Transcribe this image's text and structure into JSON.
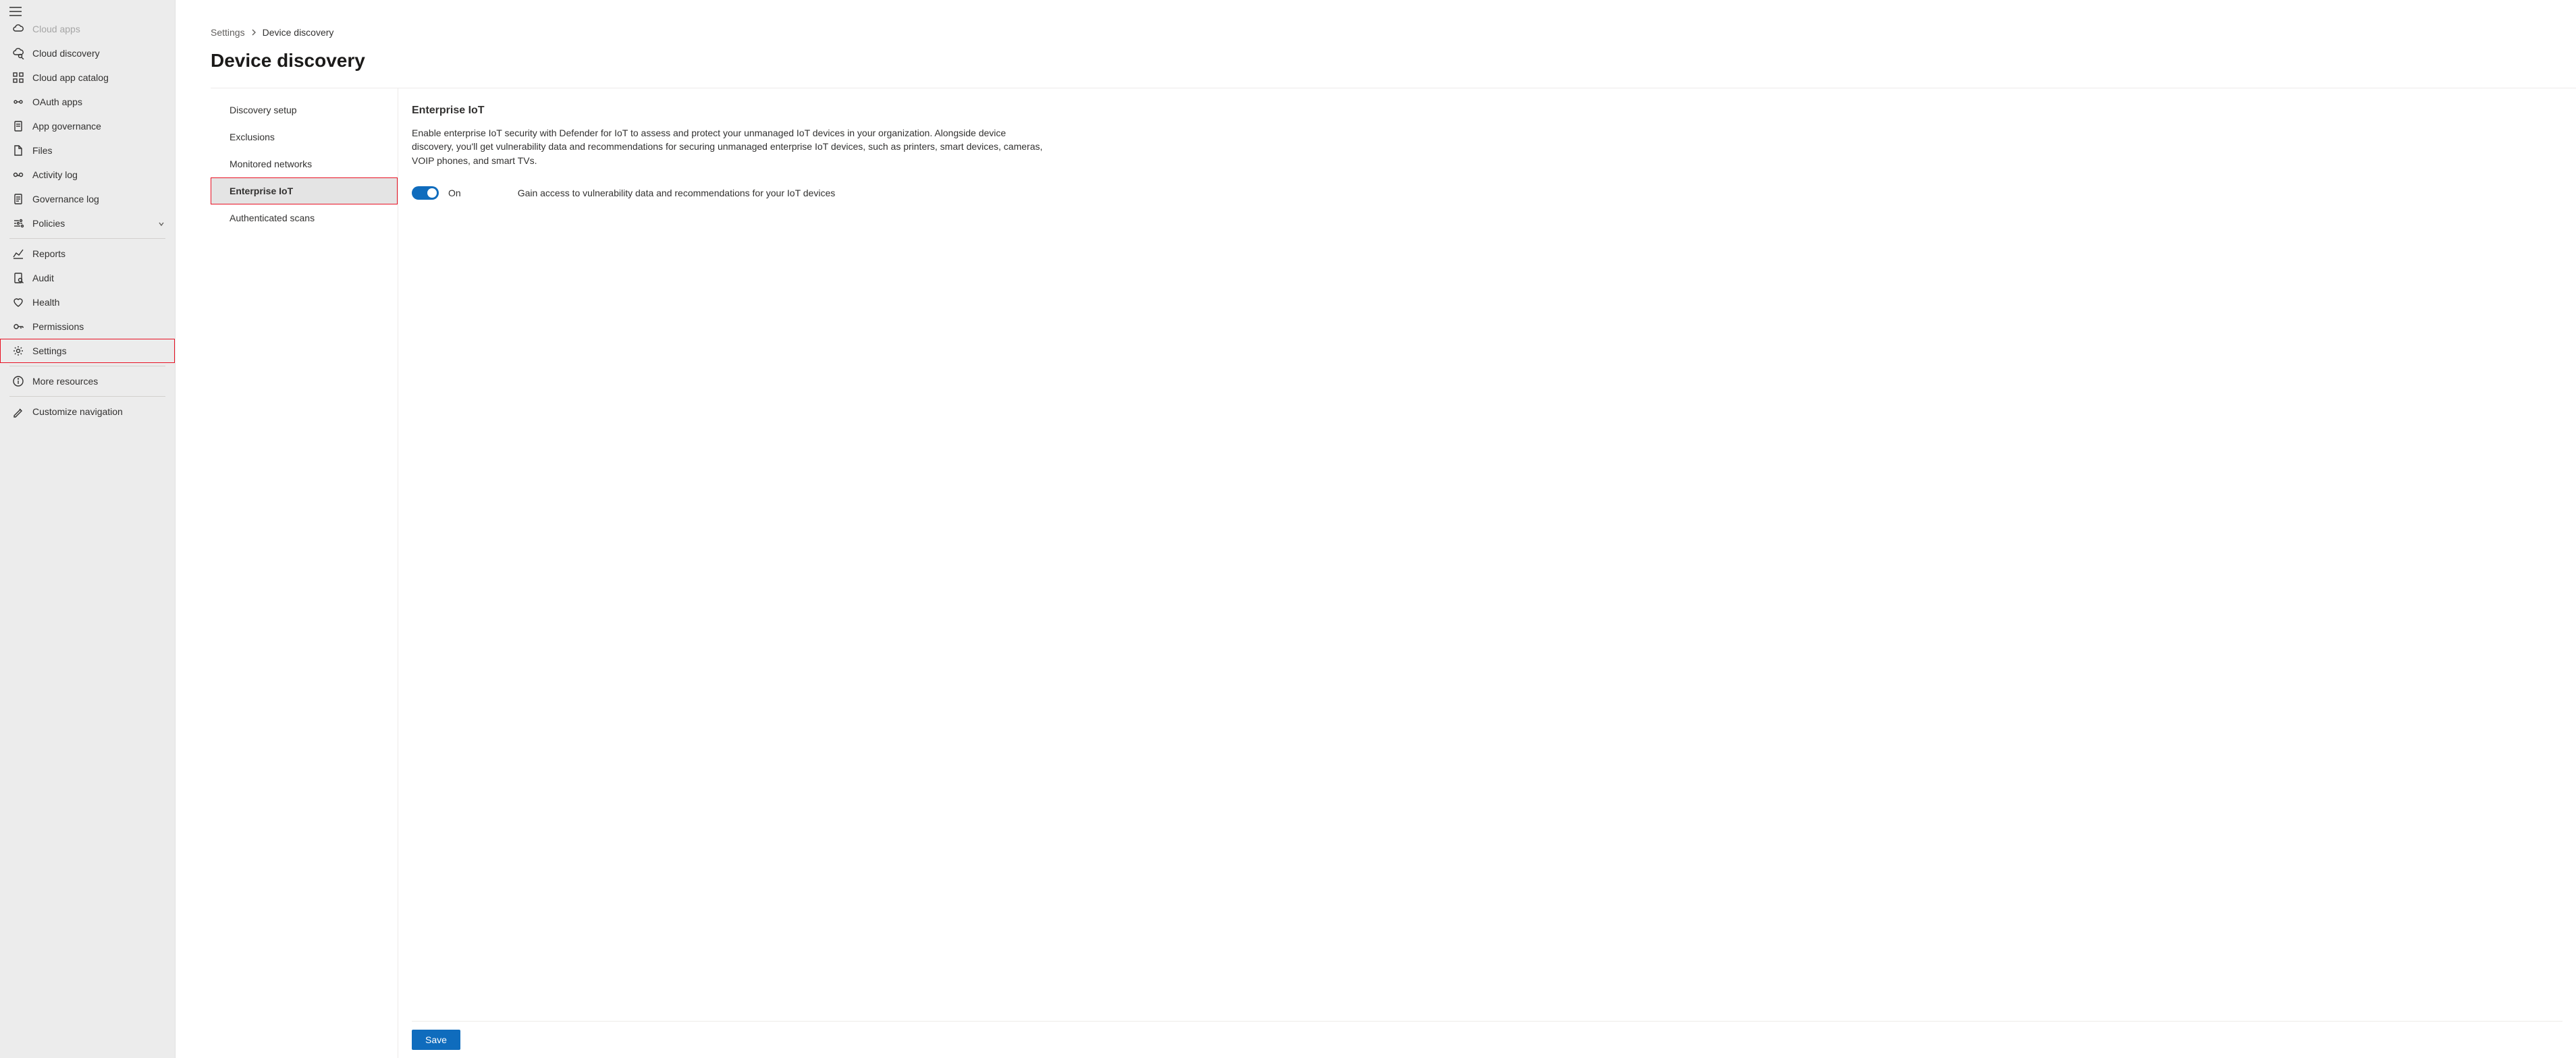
{
  "sidebar": {
    "items": [
      {
        "label": "Cloud apps",
        "icon": "cloud-apps-icon",
        "truncated": true
      },
      {
        "label": "Cloud discovery",
        "icon": "cloud-discovery-icon"
      },
      {
        "label": "Cloud app catalog",
        "icon": "catalog-icon"
      },
      {
        "label": "OAuth apps",
        "icon": "oauth-icon"
      },
      {
        "label": "App governance",
        "icon": "governance-icon"
      },
      {
        "label": "Files",
        "icon": "files-icon"
      },
      {
        "label": "Activity log",
        "icon": "activity-icon"
      },
      {
        "label": "Governance log",
        "icon": "log-icon"
      },
      {
        "label": "Policies",
        "icon": "policies-icon",
        "expandable": true
      }
    ],
    "items2": [
      {
        "label": "Reports",
        "icon": "reports-icon"
      },
      {
        "label": "Audit",
        "icon": "audit-icon"
      },
      {
        "label": "Health",
        "icon": "health-icon"
      },
      {
        "label": "Permissions",
        "icon": "permissions-icon"
      },
      {
        "label": "Settings",
        "icon": "settings-icon",
        "highlight": true
      }
    ],
    "items3": [
      {
        "label": "More resources",
        "icon": "info-icon"
      }
    ],
    "items4": [
      {
        "label": "Customize navigation",
        "icon": "edit-icon"
      }
    ]
  },
  "breadcrumb": {
    "root": "Settings",
    "current": "Device discovery"
  },
  "page": {
    "title": "Device discovery"
  },
  "subnav": {
    "items": [
      {
        "label": "Discovery setup"
      },
      {
        "label": "Exclusions"
      },
      {
        "label": "Monitored networks"
      },
      {
        "label": "Enterprise IoT",
        "selected": true,
        "highlight": true
      },
      {
        "label": "Authenticated scans"
      }
    ]
  },
  "content": {
    "heading": "Enterprise IoT",
    "description": "Enable enterprise IoT security with Defender for IoT to assess and protect your unmanaged IoT devices in your organization. Alongside device discovery, you'll get vulnerability data and recommendations for securing unmanaged enterprise IoT devices, such as printers, smart devices, cameras, VOIP phones, and smart TVs.",
    "toggle_state": "On",
    "toggle_help": "Gain access to vulnerability data and recommendations for your IoT devices",
    "save_label": "Save"
  }
}
